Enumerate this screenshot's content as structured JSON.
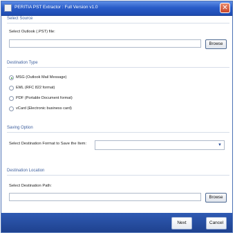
{
  "window": {
    "title": "PERITIA PST Extractor : Full Version v1.0",
    "close_glyph": "✕"
  },
  "source": {
    "header": "Select Source",
    "label": "Select Outlook (.PST) file:",
    "value": "",
    "browse_label": "Browse"
  },
  "destination_type": {
    "header": "Destination Type",
    "options": [
      {
        "label": "MSG (Outlook Mail Message)",
        "selected": true
      },
      {
        "label": "EML (RFC 822 format)",
        "selected": false
      },
      {
        "label": "PDF (Portable Document format)",
        "selected": false
      },
      {
        "label": "vCard (Electronic business card)",
        "selected": false
      }
    ]
  },
  "saving": {
    "header": "Saving Option",
    "label": "Select Destination Format to Save the Item:",
    "value": "",
    "arrow_icon": "chevron-down-icon"
  },
  "destination_location": {
    "header": "Destination Location",
    "label": "Select Destination Path:",
    "value": "",
    "browse_label": "Browse"
  },
  "footer": {
    "next_label": "Next",
    "cancel_label": "Cancel"
  },
  "colors": {
    "titlebar": "#2a5cc8",
    "section_header": "#3d5f9e",
    "footer": "#1f428f"
  }
}
